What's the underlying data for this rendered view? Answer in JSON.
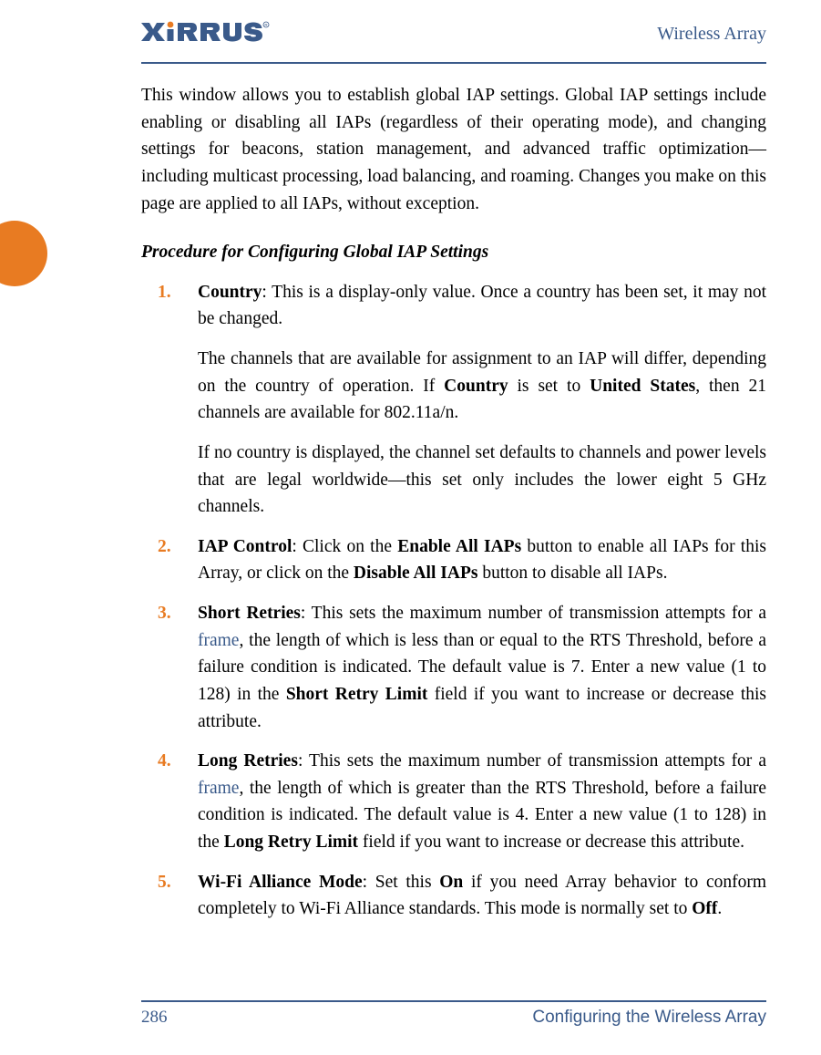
{
  "header": {
    "right": "Wireless Array",
    "logo_alt": "XIRRUS"
  },
  "intro": "This window allows you to establish global IAP settings. Global IAP settings include enabling or disabling all IAPs (regardless of their operating mode), and changing settings for beacons, station management, and advanced traffic optimization—including multicast processing, load balancing, and roaming. Changes you make on this page are applied to all IAPs, without exception.",
  "subheading": "Procedure for Configuring Global IAP Settings",
  "steps": {
    "1": {
      "num": "1.",
      "head": "Country",
      "tail1": ": This is a display-only value. Once a country has been set, it may not be changed.",
      "p2a": "The channels that are available for assignment to an IAP will differ, depending on the country of operation. If ",
      "p2b": "Country",
      "p2c": " is set to ",
      "p2d": "United States",
      "p2e": ", then 21 channels are available for 802.11a/n.",
      "p3": "If no country is displayed, the channel set defaults to channels and power levels that are legal worldwide—this set only includes the lower eight 5 GHz channels."
    },
    "2": {
      "num": "2.",
      "head": "IAP Control",
      "a": ": Click on the ",
      "b": "Enable All IAPs",
      "c": " button to enable all IAPs for this Array, or click on the ",
      "d": "Disable All IAPs",
      "e": " button to disable all IAPs."
    },
    "3": {
      "num": "3.",
      "head": "Short Retries",
      "a": ": This sets the maximum number of transmission attempts for a ",
      "link": "frame",
      "b": ", the length of which is less than or equal to the RTS Threshold, before a failure condition is indicated. The default value is 7. Enter a new value (1 to 128) in the ",
      "field": "Short Retry Limit",
      "c": " field if you want to increase or decrease this attribute."
    },
    "4": {
      "num": "4.",
      "head": "Long Retries",
      "a": ": This sets the maximum number of transmission attempts for a ",
      "link": "frame",
      "b": ", the length of which is greater than the RTS Threshold, before a failure condition is indicated. The default value is 4. Enter a new value (1 to 128) in the ",
      "field": "Long Retry Limit",
      "c": " field if you want to increase or decrease this attribute."
    },
    "5": {
      "num": "5.",
      "head": "Wi-Fi Alliance Mode",
      "a": ": Set this ",
      "on": "On",
      "b": " if you need Array behavior to conform completely to Wi-Fi Alliance standards. This mode is normally set to ",
      "off": "Off",
      "c": "."
    }
  },
  "footer": {
    "page": "286",
    "section": "Configuring the Wireless Array"
  }
}
